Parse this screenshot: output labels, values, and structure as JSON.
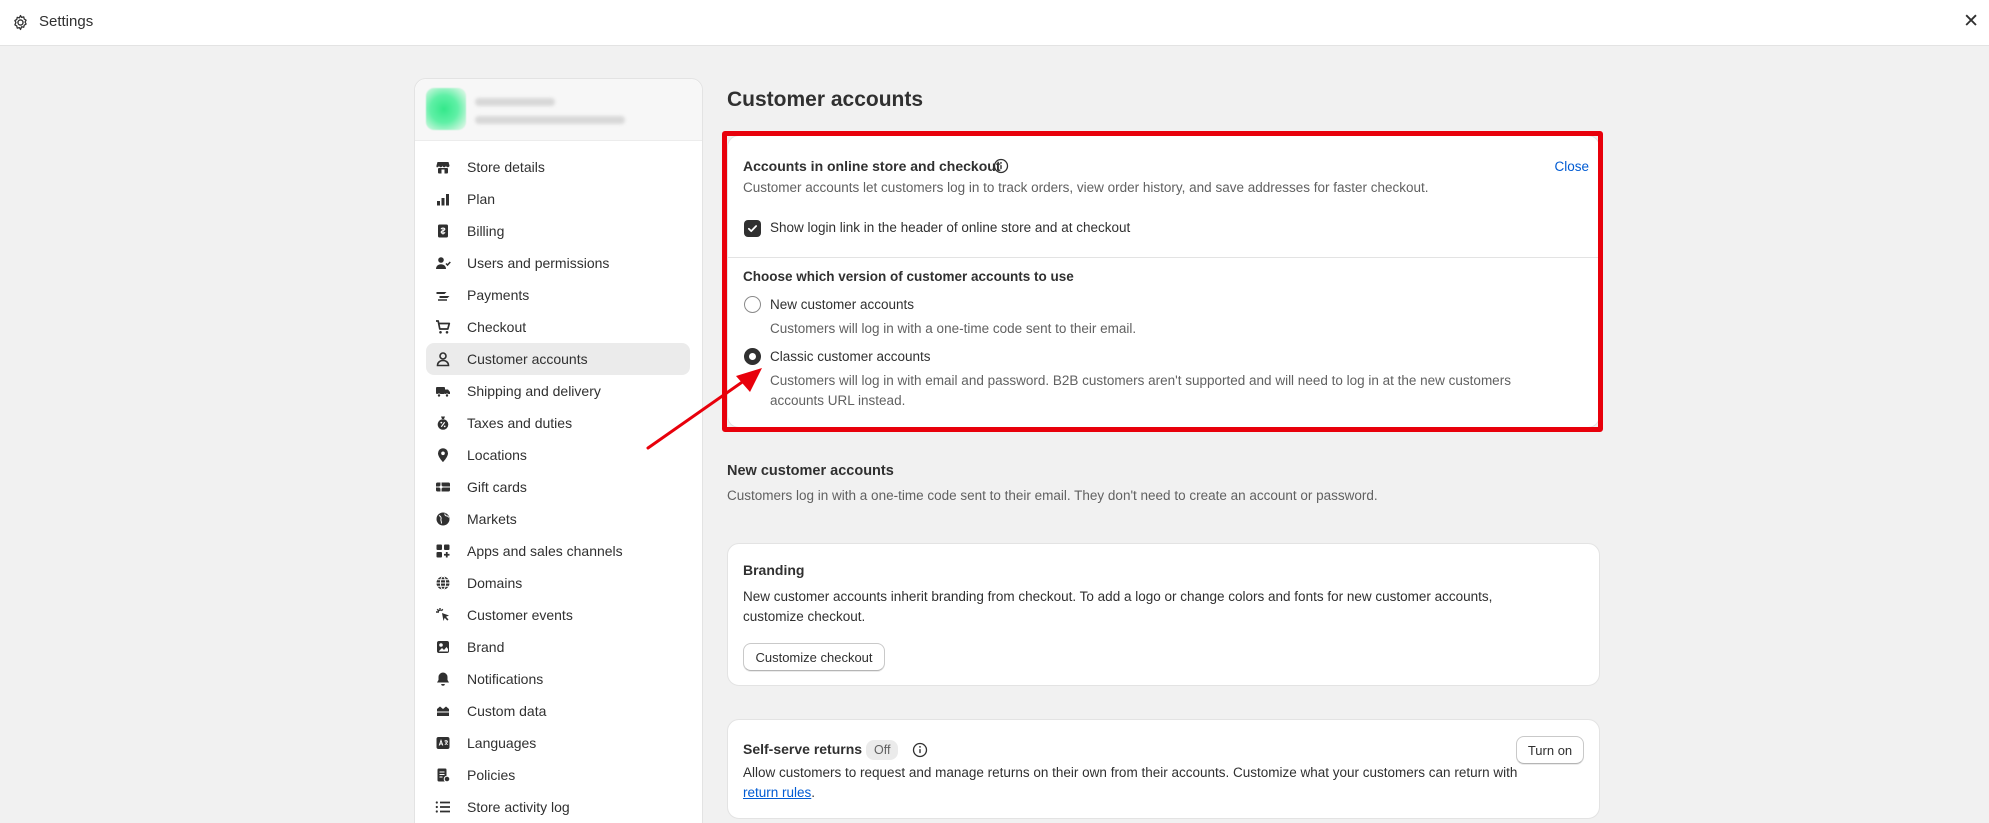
{
  "window": {
    "title": "Settings"
  },
  "sidebar": {
    "items": [
      {
        "label": "Store details",
        "icon": "store-icon"
      },
      {
        "label": "Plan",
        "icon": "plan-icon"
      },
      {
        "label": "Billing",
        "icon": "billing-icon"
      },
      {
        "label": "Users and permissions",
        "icon": "users-icon"
      },
      {
        "label": "Payments",
        "icon": "payments-icon"
      },
      {
        "label": "Checkout",
        "icon": "cart-icon"
      },
      {
        "label": "Customer accounts",
        "icon": "person-icon"
      },
      {
        "label": "Shipping and delivery",
        "icon": "truck-icon"
      },
      {
        "label": "Taxes and duties",
        "icon": "tax-icon"
      },
      {
        "label": "Locations",
        "icon": "location-icon"
      },
      {
        "label": "Gift cards",
        "icon": "gift-card-icon"
      },
      {
        "label": "Markets",
        "icon": "globe-icon"
      },
      {
        "label": "Apps and sales channels",
        "icon": "apps-icon"
      },
      {
        "label": "Domains",
        "icon": "domains-icon"
      },
      {
        "label": "Customer events",
        "icon": "cursor-icon"
      },
      {
        "label": "Brand",
        "icon": "brand-icon"
      },
      {
        "label": "Notifications",
        "icon": "bell-icon"
      },
      {
        "label": "Custom data",
        "icon": "database-icon"
      },
      {
        "label": "Languages",
        "icon": "language-icon"
      },
      {
        "label": "Policies",
        "icon": "policies-icon"
      },
      {
        "label": "Store activity log",
        "icon": "list-icon"
      }
    ],
    "active_index": 6
  },
  "main": {
    "title": "Customer accounts",
    "accounts_card": {
      "heading": "Accounts in online store and checkout",
      "close_label": "Close",
      "description": "Customer accounts let customers log in to track orders, view order history, and save addresses for faster checkout.",
      "checkbox_label": "Show login link in the header of online store and at checkout",
      "checkbox_checked": true,
      "version_heading": "Choose which version of customer accounts to use",
      "options": [
        {
          "label": "New customer accounts",
          "help": "Customers will log in with a one-time code sent to their email.",
          "selected": false
        },
        {
          "label": "Classic customer accounts",
          "help_line1": "Customers will log in with email and password. B2B customers aren't supported and will need to log in at the new customers",
          "help_line2": "accounts URL instead.",
          "selected": true
        }
      ]
    },
    "new_accounts_section": {
      "heading": "New customer accounts",
      "description": "Customers log in with a one-time code sent to their email. They don't need to create an account or password."
    },
    "branding_card": {
      "heading": "Branding",
      "line1": "New customer accounts inherit branding from checkout. To add a logo or change colors and fonts for new customer accounts,",
      "line2": "customize checkout.",
      "button_label": "Customize checkout"
    },
    "returns_card": {
      "heading": "Self-serve returns",
      "badge": "Off",
      "button_label": "Turn on",
      "line1": "Allow customers to request and manage returns on their own from their accounts. Customize what your customers can return with",
      "link": "return rules",
      "after_link": "."
    }
  },
  "colors": {
    "annotation": "#e8000b",
    "link": "#005bd3"
  }
}
